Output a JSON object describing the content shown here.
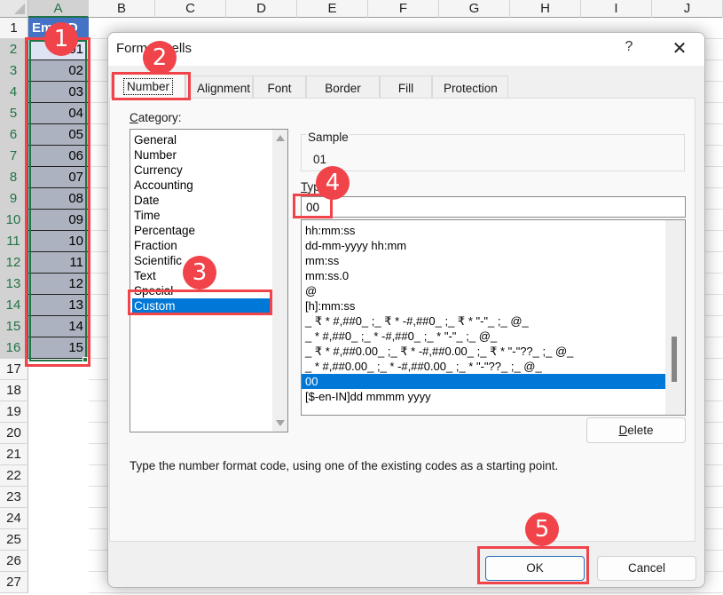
{
  "spreadsheet": {
    "columns": [
      "A",
      "B",
      "C",
      "D",
      "E",
      "F",
      "G",
      "H",
      "I",
      "J"
    ],
    "rows": [
      "1",
      "2",
      "3",
      "4",
      "5",
      "6",
      "7",
      "8",
      "9",
      "10",
      "11",
      "12",
      "13",
      "14",
      "15",
      "16",
      "17",
      "18",
      "19",
      "20",
      "21",
      "22",
      "23",
      "24",
      "25",
      "26",
      "27"
    ],
    "column_a": {
      "header": "Emp ID",
      "values": [
        "01",
        "02",
        "03",
        "04",
        "05",
        "06",
        "07",
        "08",
        "09",
        "10",
        "11",
        "12",
        "13",
        "14",
        "15"
      ]
    }
  },
  "dialog": {
    "title": "Format Cells",
    "help_label": "?",
    "close_label": "✕",
    "tabs": [
      {
        "label": "Number",
        "active": true
      },
      {
        "label": "Alignment"
      },
      {
        "label": "Font"
      },
      {
        "label": "Border"
      },
      {
        "label": "Fill"
      },
      {
        "label": "Protection"
      }
    ],
    "category": {
      "label_prefix": "C",
      "label_rest": "ategory:",
      "items": [
        "General",
        "Number",
        "Currency",
        "Accounting",
        "Date",
        "Time",
        "Percentage",
        "Fraction",
        "Scientific",
        "Text",
        "Special",
        "Custom"
      ],
      "selected": "Custom"
    },
    "sample": {
      "label": "Sample",
      "value": "01"
    },
    "type": {
      "label_prefix": "T",
      "label_rest": "ype:",
      "value": "00",
      "list": [
        "hh:mm:ss",
        "dd-mm-yyyy hh:mm",
        "mm:ss",
        "mm:ss.0",
        "@",
        "[h]:mm:ss",
        "_ ₹ * #,##0_ ;_ ₹ * -#,##0_ ;_ ₹ * \"-\"_ ;_ @_",
        "_ * #,##0_ ;_ * -#,##0_ ;_ * \"-\"_ ;_ @_",
        "_ ₹ * #,##0.00_ ;_ ₹ * -#,##0.00_ ;_ ₹ * \"-\"??_ ;_ @_",
        "_ * #,##0.00_ ;_ * -#,##0.00_ ;_ * \"-\"??_ ;_ @_",
        "00",
        "[$-en-IN]dd mmmm yyyy"
      ],
      "selected": "00"
    },
    "delete_label_prefix": "D",
    "delete_label_rest": "elete",
    "hint": "Type the number format code, using one of the existing codes as a starting point.",
    "ok_label": "OK",
    "cancel_label": "Cancel"
  },
  "callouts": [
    "1",
    "2",
    "3",
    "4",
    "5"
  ],
  "colors": {
    "callout": "#f0434a",
    "selection": "#0078d7",
    "excel_green": "#217346",
    "header_fill": "#4472c4",
    "selected_cells": "#acb2bf"
  }
}
